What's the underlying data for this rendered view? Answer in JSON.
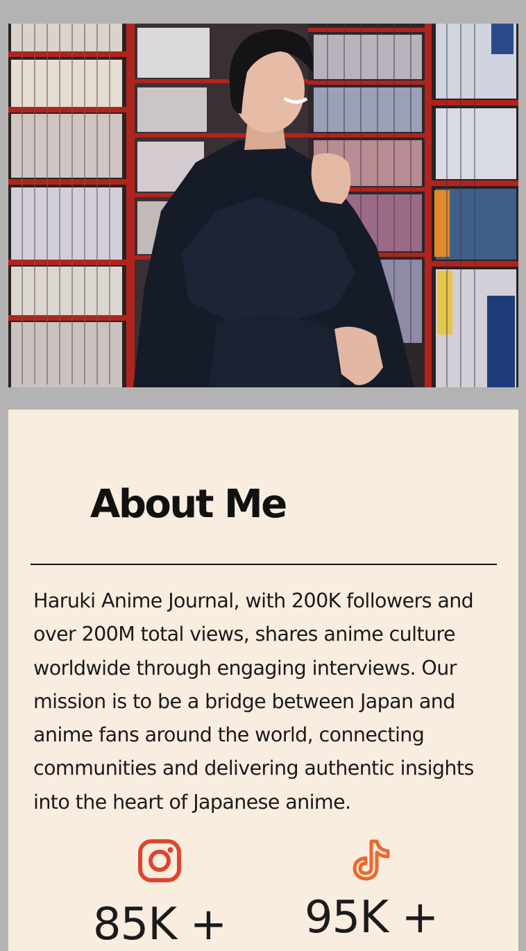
{
  "about": {
    "title": "About Me",
    "bio": "Haruki Anime Journal, with 200K followers and over 200M total views, shares anime culture worldwide through engaging interviews. Our mission is to be a bridge between Japan and anime fans around the world, connecting communities and delivering authentic insights into the heart of Japanese anime."
  },
  "hero": {
    "icon": "profile-photo-bookstore"
  },
  "stats": [
    {
      "icon": "instagram-icon",
      "count": "85K +",
      "color": "#e0442b"
    },
    {
      "icon": "tiktok-icon",
      "count": "95K +",
      "color": "#ea6a2c"
    }
  ],
  "colors": {
    "background": "#b3b3b3",
    "card": "#f9ede0",
    "text": "#1a1a1a"
  }
}
